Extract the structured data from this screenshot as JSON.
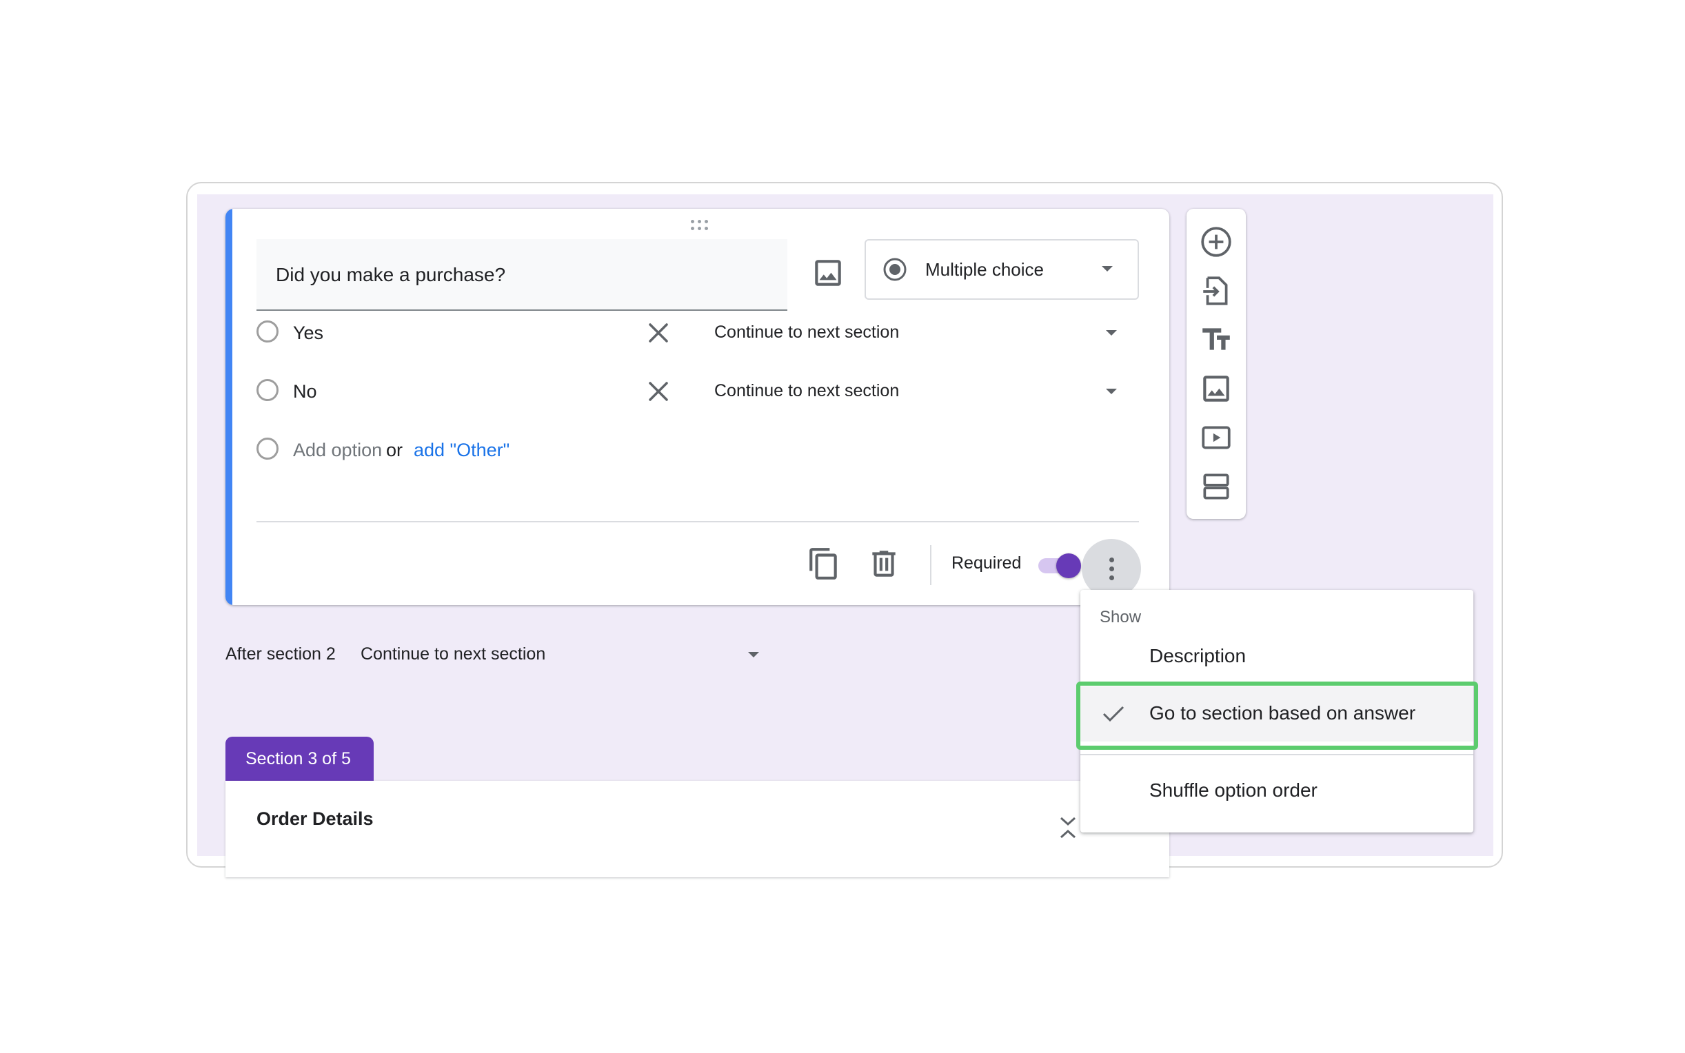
{
  "question": {
    "title": "Did you make a purchase?",
    "type": "Multiple choice",
    "options": [
      {
        "label": "Yes",
        "goto": "Continue to next section"
      },
      {
        "label": "No",
        "goto": "Continue to next section"
      }
    ],
    "add_option": "Add option",
    "or_text": "or",
    "add_other": "add \"Other\"",
    "required_label": "Required",
    "required": true
  },
  "toolbar": {
    "icons": [
      "add-question-icon",
      "import-questions-icon",
      "add-title-icon",
      "add-image-icon",
      "add-video-icon",
      "add-section-icon"
    ]
  },
  "after_section": {
    "label": "After section 2",
    "value": "Continue to next section"
  },
  "section": {
    "tab": "Section 3 of 5",
    "title": "Order Details"
  },
  "menu": {
    "header": "Show",
    "items": [
      {
        "label": "Description",
        "checked": false
      },
      {
        "label": "Go to section based on answer",
        "checked": true
      },
      {
        "label": "Shuffle option order",
        "checked": false
      }
    ]
  },
  "colors": {
    "accent": "#673ab7",
    "card_accent": "#4285f4",
    "background": "#f0ebf8",
    "highlight_border": "#5ccc6e",
    "link": "#1a73e8"
  }
}
